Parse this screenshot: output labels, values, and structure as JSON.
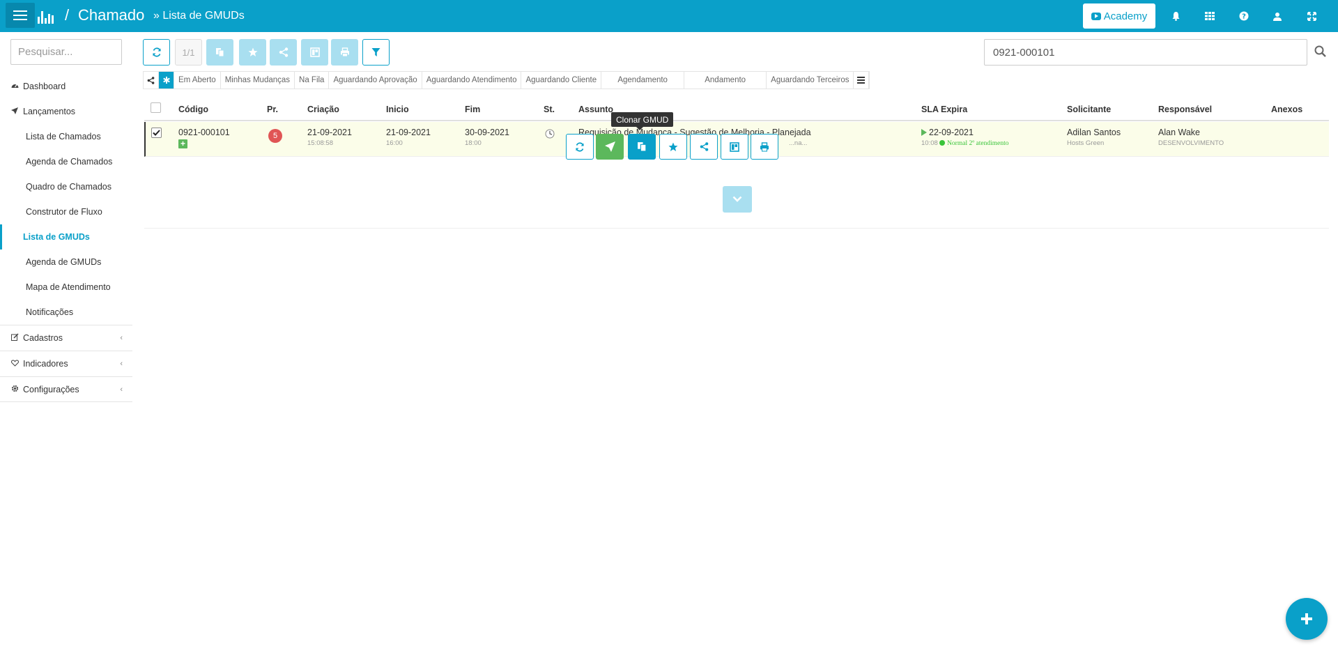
{
  "header": {
    "app_name": "Chamado",
    "separator": "/",
    "breadcrumb": "» Lista de GMUDs",
    "academy_label": "Academy",
    "icons": [
      "bell-icon",
      "grid-icon",
      "question-icon",
      "user-icon",
      "expand-icon"
    ]
  },
  "sidebar": {
    "search_placeholder": "Pesquisar...",
    "items": {
      "dashboard": "Dashboard",
      "lancamentos": "Lançamentos",
      "lista_chamados": "Lista de Chamados",
      "agenda_chamados": "Agenda de Chamados",
      "quadro_chamados": "Quadro de Chamados",
      "construtor_fluxo": "Construtor de Fluxo",
      "lista_gmuds": "Lista de GMUDs",
      "agenda_gmuds": "Agenda de GMUDs",
      "mapa_atendimento": "Mapa de Atendimento",
      "notificacoes": "Notificações",
      "cadastros": "Cadastros",
      "indicadores": "Indicadores",
      "configuracoes": "Configurações"
    },
    "active": "Lista de GMUDs"
  },
  "toolbar": {
    "pager": "1/1",
    "search_value": "0921-000101"
  },
  "tabs": {
    "em_aberto": "Em Aberto",
    "minhas_mudancas": "Minhas Mudanças",
    "na_fila": "Na Fila",
    "aguardando_aprovacao": "Aguardando Aprovação",
    "aguardando_atendimento": "Aguardando Atendimento",
    "aguardando_cliente": "Aguardando Cliente",
    "agendamento": "Agendamento",
    "andamento": "Andamento",
    "aguardando_terceiros": "Aguardando Terceiros"
  },
  "table": {
    "headers": {
      "codigo": "Código",
      "pr": "Pr.",
      "criacao": "Criação",
      "inicio": "Inicio",
      "fim": "Fim",
      "st": "St.",
      "assunto": "Assunto",
      "sla": "SLA Expira",
      "solicitante": "Solicitante",
      "responsavel": "Responsável",
      "anexos": "Anexos"
    },
    "row": {
      "codigo": "0921-000101",
      "prioridade": "5",
      "criacao_data": "21-09-2021",
      "criacao_hora": "15:08:58",
      "inicio_data": "21-09-2021",
      "inicio_hora": "16:00",
      "fim_data": "30-09-2021",
      "fim_hora": "18:00",
      "assunto": "Requisição de Mudança - Sugestão de Melhoria - Planejada",
      "assunto_sub": "...na...",
      "sla_data": "22-09-2021",
      "sla_hora": "10:08",
      "sla_status": "Normal 2º atendimento",
      "solicitante": "Adilan Santos",
      "solicitante_org": "Hosts Green",
      "responsavel": "Alan Wake",
      "responsavel_setor": "DESENVOLVIMENTO"
    }
  },
  "tooltip": "Clonar GMUD",
  "colors": {
    "primary": "#0aa0c9",
    "primary_light": "#a9dff0",
    "success": "#5cb85c",
    "danger": "#e05555",
    "row_highlight": "#fbfde9"
  }
}
